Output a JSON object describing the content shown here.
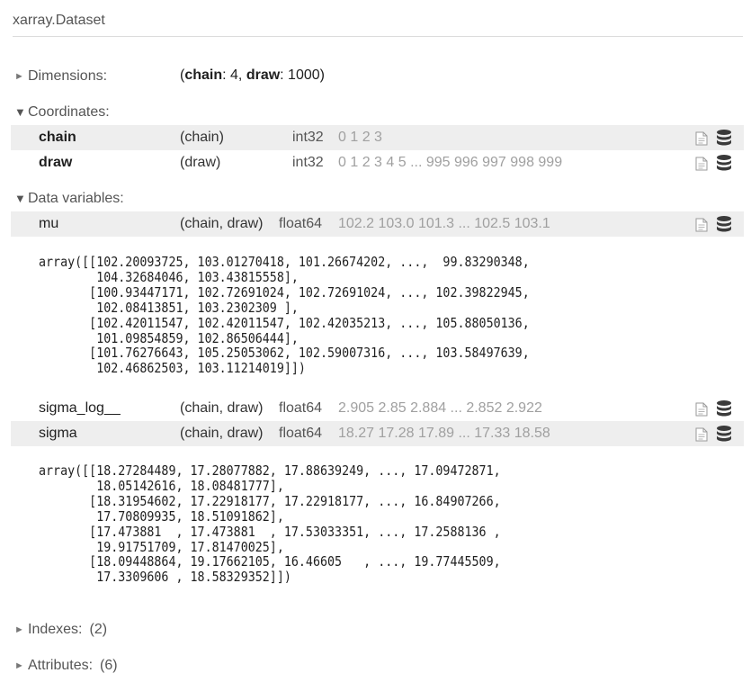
{
  "header": {
    "title": "xarray.Dataset"
  },
  "dimensions": {
    "label": "Dimensions:",
    "open": "(",
    "chain_key": "chain",
    "chain_val": ": 4, ",
    "draw_key": "draw",
    "draw_val": ": 1000)"
  },
  "coordinates": {
    "label": "Coordinates:",
    "rows": [
      {
        "name": "chain",
        "dims": "(chain)",
        "dtype": "int32",
        "preview": "0 1 2 3"
      },
      {
        "name": "draw",
        "dims": "(draw)",
        "dtype": "int32",
        "preview": "0 1 2 3 4 5 ... 995 996 997 998 999"
      }
    ]
  },
  "data_variables": {
    "label": "Data variables:",
    "rows": [
      {
        "name": "mu",
        "dims": "(chain, draw)",
        "dtype": "float64",
        "preview": "102.2 103.0 101.3 ... 102.5 103.1",
        "array": "array([[102.20093725, 103.01270418, 101.26674202, ...,  99.83290348,\n        104.32684046, 103.43815558],\n       [100.93447171, 102.72691024, 102.72691024, ..., 102.39822945,\n        102.08413851, 103.2302309 ],\n       [102.42011547, 102.42011547, 102.42035213, ..., 105.88050136,\n        101.09854859, 102.86506444],\n       [101.76276643, 105.25053062, 102.59007316, ..., 103.58497639,\n        102.46862503, 103.11214019]])"
      },
      {
        "name": "sigma_log__",
        "dims": "(chain, draw)",
        "dtype": "float64",
        "preview": "2.905 2.85 2.884 ... 2.852 2.922"
      },
      {
        "name": "sigma",
        "dims": "(chain, draw)",
        "dtype": "float64",
        "preview": "18.27 17.28 17.89 ... 17.33 18.58",
        "array": "array([[18.27284489, 17.28077882, 17.88639249, ..., 17.09472871,\n        18.05142616, 18.08481777],\n       [18.31954602, 17.22918177, 17.22918177, ..., 16.84907266,\n        17.70809935, 18.51091862],\n       [17.473881  , 17.473881  , 17.53033351, ..., 17.2588136 ,\n        19.91751709, 17.81470025],\n       [18.09448864, 19.17662105, 16.46605   , ..., 19.77445509,\n        17.3309606 , 18.58329352]])"
      }
    ]
  },
  "indexes": {
    "label": "Indexes:",
    "count": "(2)"
  },
  "attributes": {
    "label": "Attributes:",
    "count": "(6)"
  }
}
